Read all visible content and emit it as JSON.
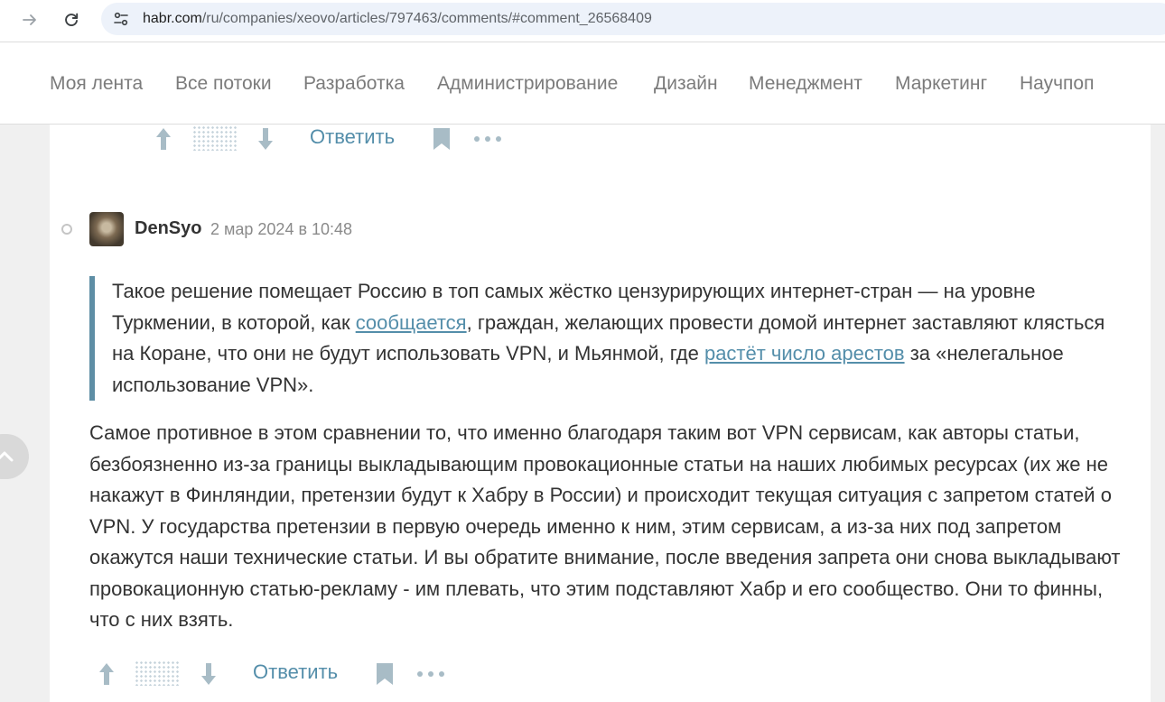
{
  "browser": {
    "url_host": "habr.com",
    "url_path": "/ru/companies/xeovo/articles/797463/comments/#comment_26568409"
  },
  "nav": {
    "tabs": [
      "Моя лента",
      "Все потоки",
      "Разработка",
      "Администрирование",
      "Дизайн",
      "Менеджмент",
      "Маркетинг",
      "Научпоп"
    ]
  },
  "prev_comment": {
    "reply_label": "Ответить"
  },
  "comment": {
    "author": "DenSyo",
    "date": "2 мар 2024 в 10:48",
    "quote": {
      "part1": "Такое решение помещает Россию в топ самых жёстко цензурирующих интернет-стран — на уровне Туркмении, в которой, как ",
      "link1": "сообщается",
      "part2": ", граждан, желающих провести домой интернет заставляют клясться на Коране, что они не будут использовать VPN, и Мьянмой, где ",
      "link2": "растёт число арестов",
      "part3": " за «нелегальное использование VPN»."
    },
    "body": "Самое противное в этом сравнении то, что именно благодаря таким вот VPN сервисам, как авторы статьи, безбоязненно из-за границы выкладывающим провокационные статьи на наших любимых ресурсах (их же не накажут в Финляндии, претензии будут к Хабру в России) и происходит текущая ситуация с запретом статей о VPN. У государства претензии в первую очередь именно к ним, этим сервисам, а из-за них под запретом окажутся наши технические статьи. И вы обратите внимание, после введения запрета они снова выкладывают провокационную статью-рекламу - им плевать, что этим подставляют Хабр и его сообщество. Они то финны, что с них взять.",
    "reply_label": "Ответить"
  },
  "colors": {
    "accent": "#548eaa",
    "quote_border": "#5e8ea5",
    "icon": "#a8bcc6",
    "nav_text": "#7b7b7b"
  },
  "icons": {
    "forward": "arrow-right-icon",
    "reload": "reload-icon",
    "site_info": "tune-icon",
    "vote_up": "arrow-up-icon",
    "vote_down": "arrow-down-icon",
    "bookmark": "bookmark-icon",
    "more": "more-dots-icon",
    "scroll_up": "chevron-up-icon"
  }
}
